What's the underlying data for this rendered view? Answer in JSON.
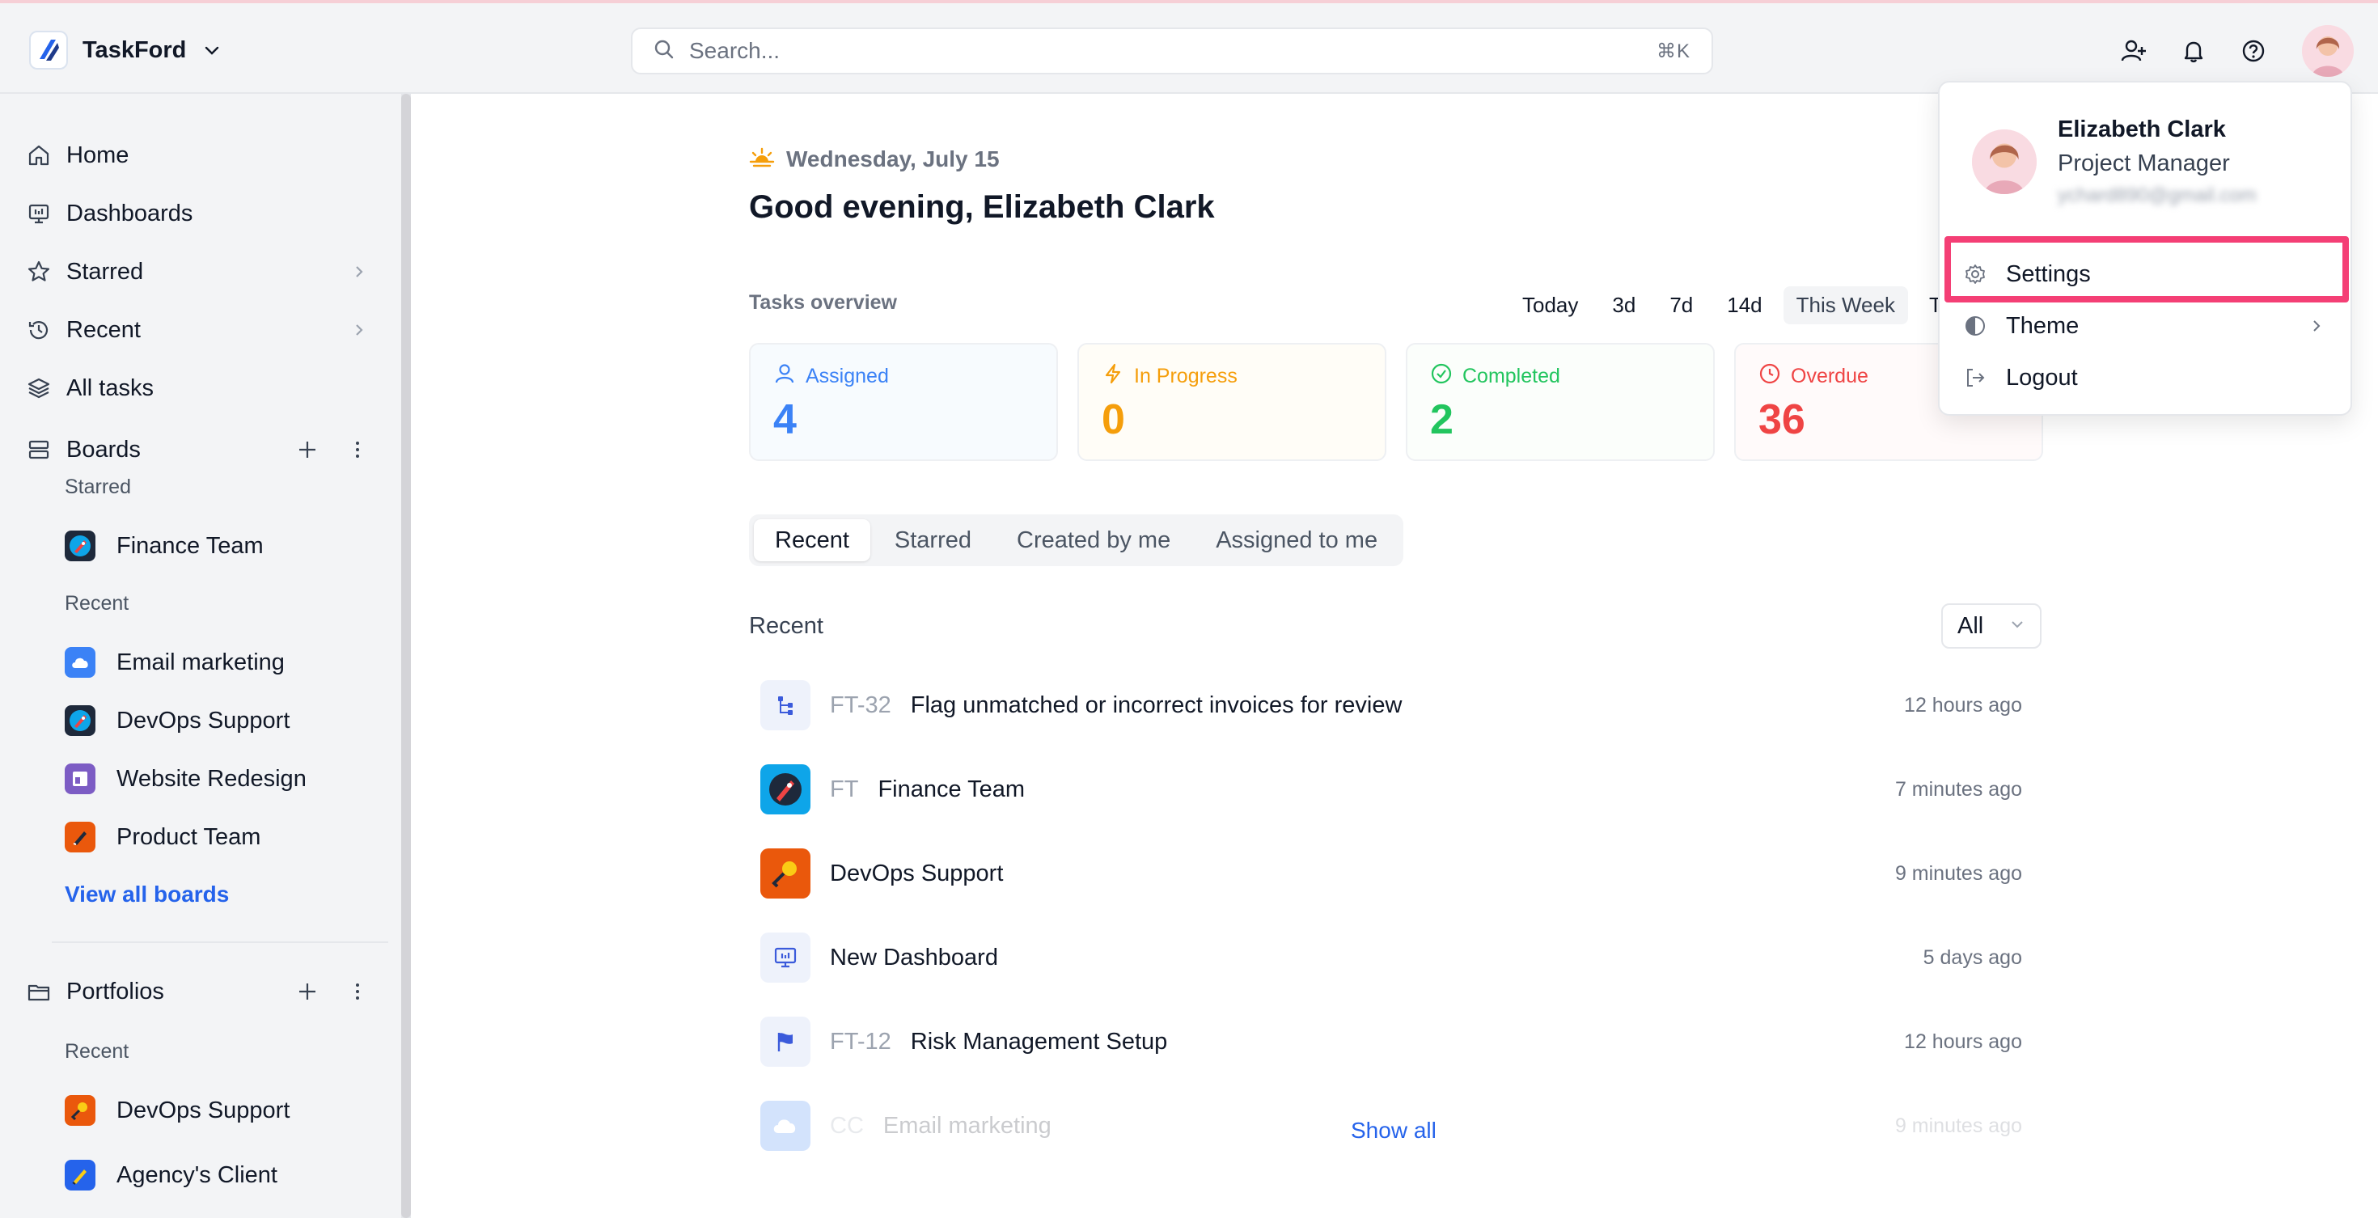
{
  "app": {
    "name": "TaskFord"
  },
  "search": {
    "placeholder": "Search...",
    "shortcut": "⌘K"
  },
  "sidebar": {
    "nav": [
      {
        "label": "Home"
      },
      {
        "label": "Dashboards"
      },
      {
        "label": "Starred"
      },
      {
        "label": "Recent"
      },
      {
        "label": "All tasks"
      }
    ],
    "boards": {
      "title": "Boards",
      "starred_label": "Starred",
      "starred": [
        {
          "label": "Finance Team"
        }
      ],
      "recent_label": "Recent",
      "recent": [
        {
          "label": "Email marketing"
        },
        {
          "label": "DevOps Support"
        },
        {
          "label": "Website Redesign"
        },
        {
          "label": "Product Team"
        }
      ],
      "view_all": "View all boards"
    },
    "portfolios": {
      "title": "Portfolios",
      "recent_label": "Recent",
      "recent": [
        {
          "label": "DevOps Support"
        },
        {
          "label": "Agency's Client"
        }
      ]
    }
  },
  "main": {
    "date": "Wednesday, July 15",
    "greeting": "Good evening, Elizabeth Clark",
    "overview": {
      "title": "Tasks overview",
      "ranges": [
        "Today",
        "3d",
        "7d",
        "14d",
        "This Week",
        "T"
      ],
      "active_range": "This Week",
      "stats": [
        {
          "label": "Assigned",
          "value": "4",
          "color": "#3b82f6"
        },
        {
          "label": "In Progress",
          "value": "0",
          "color": "#f59e0b"
        },
        {
          "label": "Completed",
          "value": "2",
          "color": "#22c55e"
        },
        {
          "label": "Overdue",
          "value": "36",
          "color": "#ef4444"
        }
      ]
    },
    "tabs": [
      "Recent",
      "Starred",
      "Created by me",
      "Assigned to me"
    ],
    "recent": {
      "title": "Recent",
      "filter": "All",
      "items": [
        {
          "key": "FT-32",
          "title": "Flag unmatched or incorrect invoices for review",
          "time": "12 hours ago"
        },
        {
          "key": "FT",
          "title": "Finance Team",
          "time": "7 minutes ago"
        },
        {
          "key": "",
          "title": "DevOps Support",
          "time": "9 minutes ago"
        },
        {
          "key": "",
          "title": "New Dashboard",
          "time": "5 days ago"
        },
        {
          "key": "FT-12",
          "title": "Risk Management Setup",
          "time": "12 hours ago"
        },
        {
          "key": "CC",
          "title": "Email marketing",
          "time": "9 minutes ago"
        }
      ],
      "show_all": "Show all"
    }
  },
  "profile_menu": {
    "name": "Elizabeth Clark",
    "role": "Project Manager",
    "email": "ychard890@gmail.com",
    "items": [
      {
        "label": "Settings"
      },
      {
        "label": "Theme"
      },
      {
        "label": "Logout"
      }
    ]
  },
  "colors": {
    "accent": "#2563eb",
    "highlight": "#f43f75"
  }
}
